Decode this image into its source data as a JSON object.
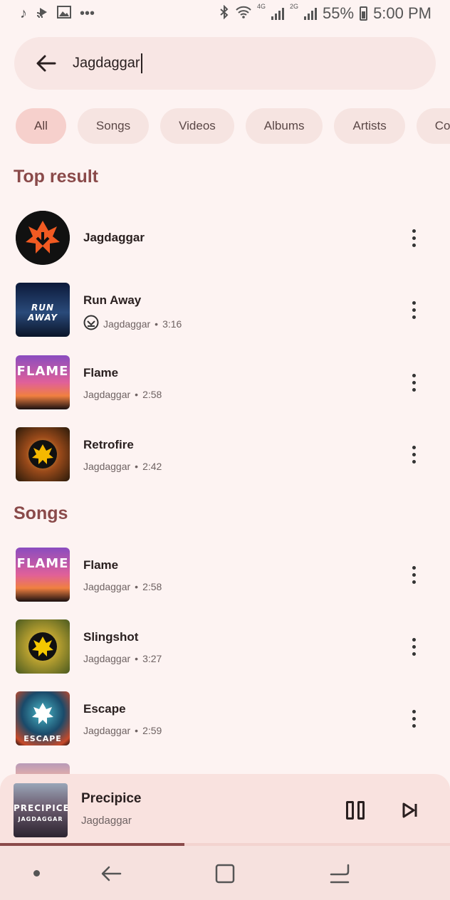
{
  "status_bar": {
    "left_icons": [
      "music-note-icon",
      "cast-icon",
      "image-icon",
      "more-dots-icon"
    ],
    "battery": "55%",
    "time": "5:00 PM",
    "network_labels": [
      "4G",
      "2G"
    ]
  },
  "search": {
    "query": "Jagdaggar"
  },
  "filter_chips": [
    {
      "label": "All",
      "active": true
    },
    {
      "label": "Songs",
      "active": false
    },
    {
      "label": "Videos",
      "active": false
    },
    {
      "label": "Albums",
      "active": false
    },
    {
      "label": "Artists",
      "active": false
    },
    {
      "label": "Comm",
      "active": false
    }
  ],
  "top_result": {
    "title": "Top result",
    "items": [
      {
        "title": "Jagdaggar",
        "subtitle": "",
        "duration": ""
      },
      {
        "title": "Run Away",
        "subtitle": "Jagdaggar",
        "duration": "3:16",
        "downloaded": true,
        "art_text": "RUN AWAY"
      },
      {
        "title": "Flame",
        "subtitle": "Jagdaggar",
        "duration": "2:58",
        "art_text": "FLAME"
      },
      {
        "title": "Retrofire",
        "subtitle": "Jagdaggar",
        "duration": "2:42"
      }
    ]
  },
  "songs": {
    "title": "Songs",
    "items": [
      {
        "title": "Flame",
        "subtitle": "Jagdaggar",
        "duration": "2:58",
        "art_text": "FLAME"
      },
      {
        "title": "Slingshot",
        "subtitle": "Jagdaggar",
        "duration": "3:27"
      },
      {
        "title": "Escape",
        "subtitle": "Jagdaggar",
        "duration": "2:59",
        "art_text": "ESCAPE"
      }
    ]
  },
  "separator": "•",
  "mini_player": {
    "title": "Precipice",
    "artist": "Jagdaggar",
    "art_text": "PRECIPICE",
    "art_subtext": "JAGDAGGAR",
    "progress": 0.41
  },
  "colors": {
    "background": "#fdf3f2",
    "accent": "#8a4a4a",
    "chip": "#f6e4e1",
    "chip_active": "#f6d0cc"
  }
}
